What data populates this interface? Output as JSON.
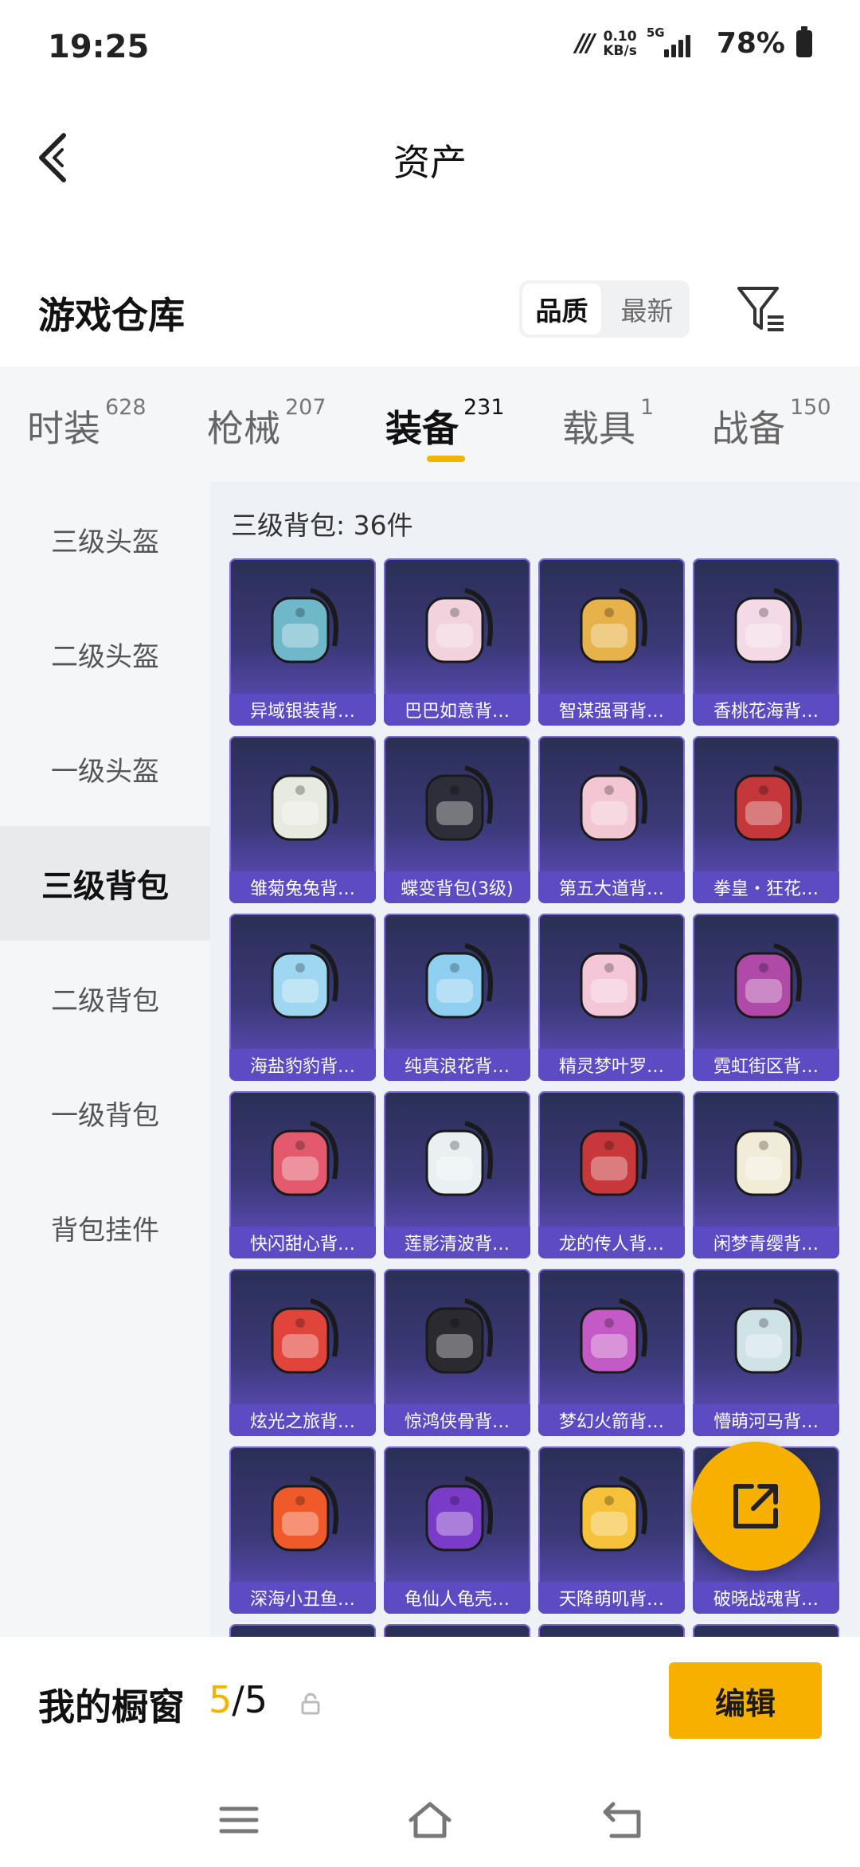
{
  "status_bar": {
    "time": "19:25",
    "net_speed_value": "0.10",
    "net_speed_unit": "KB/s",
    "network": "5G",
    "battery": "78%"
  },
  "header": {
    "title": "资产"
  },
  "section": {
    "title": "游戏仓库",
    "sort_options": [
      "品质",
      "最新"
    ],
    "sort_selected": "品质"
  },
  "tabs": [
    {
      "label": "时装",
      "count": "628"
    },
    {
      "label": "枪械",
      "count": "207"
    },
    {
      "label": "装备",
      "count": "231"
    },
    {
      "label": "载具",
      "count": "1"
    },
    {
      "label": "战备",
      "count": "150"
    }
  ],
  "active_tab": "装备",
  "sidebar": {
    "items": [
      "三级头盔",
      "二级头盔",
      "一级头盔",
      "三级背包",
      "二级背包",
      "一级背包",
      "背包挂件"
    ],
    "active": "三级背包"
  },
  "content": {
    "title": "三级背包: 36件",
    "items": [
      "异域银装背…",
      "巴巴如意背…",
      "智谋强哥背…",
      "香桃花海背…",
      "雏菊兔兔背…",
      "蝶变背包(3级)",
      "第五大道背…",
      "拳皇・狂花…",
      "海盐豹豹背…",
      "纯真浪花背…",
      "精灵梦叶罗…",
      "霓虹街区背…",
      "快闪甜心背…",
      "莲影清波背…",
      "龙的传人背…",
      "闲梦青缨背…",
      "炫光之旅背…",
      "惊鸿侠骨背…",
      "梦幻火箭背…",
      "懵萌河马背…",
      "深海小丑鱼…",
      "龟仙人龟壳…",
      "天降萌叽背…",
      "破晓战魂背…"
    ]
  },
  "showcase": {
    "label": "我的橱窗",
    "current": "5",
    "separator": "/",
    "total": "5",
    "edit_label": "编辑"
  },
  "colors": {
    "accent": "#f6b100",
    "card_purple": "#5c4bc3"
  }
}
